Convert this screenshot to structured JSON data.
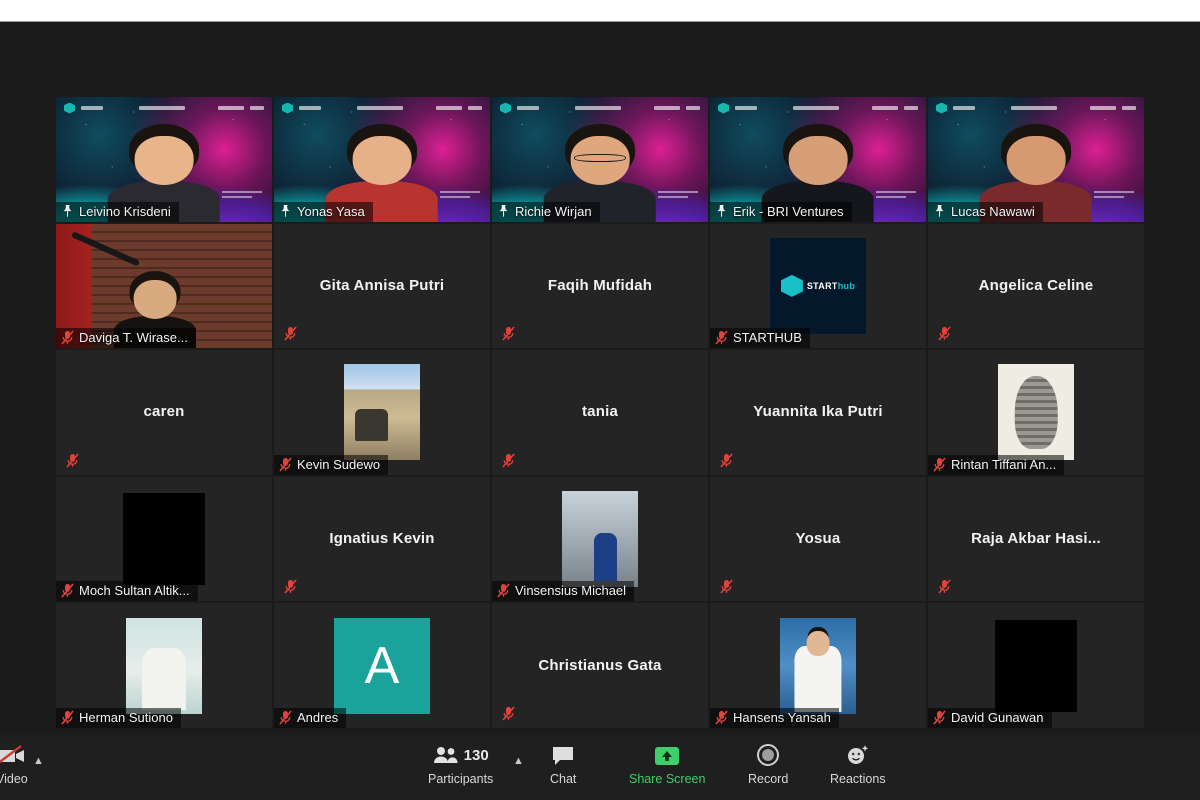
{
  "app": {
    "name": "Zoom Meeting",
    "layout": "gallery-view"
  },
  "gallery": {
    "columns": 5,
    "rows": 5,
    "active_speaker_border_color": "#c9e94a",
    "muted_icon_color": "#e0433c",
    "participants": [
      {
        "name": "Leivino Krisdeni",
        "display_name": "Leivino Krisdeni",
        "video": true,
        "muted": false,
        "pinned": true,
        "tile_type": "video-virtualbg",
        "skin": "#e8b48a",
        "shirt": "#2a2a30"
      },
      {
        "name": "Yonas Yasa",
        "display_name": "Yonas Yasa",
        "video": true,
        "muted": false,
        "pinned": true,
        "tile_type": "video-virtualbg",
        "skin": "#e6b089",
        "shirt": "#b8342f"
      },
      {
        "name": "Richie Wirjan",
        "display_name": "Richie Wirjan",
        "video": true,
        "muted": true,
        "pinned": true,
        "tile_type": "video-virtualbg",
        "skin": "#dfa77e",
        "shirt": "#20242a",
        "glasses": true
      },
      {
        "name": "Erik - BRI Ventures",
        "display_name": "Erik - BRI Ventures",
        "video": true,
        "muted": false,
        "pinned": true,
        "tile_type": "video-virtualbg",
        "skin": "#d79f78",
        "shirt": "#15171c"
      },
      {
        "name": "Lucas Nawawi",
        "display_name": "Lucas Nawawi",
        "video": true,
        "muted": false,
        "pinned": true,
        "tile_type": "video-virtualbg",
        "skin": "#d79a70",
        "shirt": "#7a2a2a",
        "active_speaker": true
      },
      {
        "name": "Daviga T. Wirase...",
        "display_name": "Daviga T. Wirase...",
        "video": true,
        "muted": true,
        "pinned": false,
        "tile_type": "video-brick"
      },
      {
        "name": "Gita Annisa Putri",
        "display_name": "Gita Annisa Putri",
        "video": false,
        "muted": true,
        "pinned": false,
        "tile_type": "name-only"
      },
      {
        "name": "Faqih Mufidah",
        "display_name": "Faqih Mufidah",
        "video": false,
        "muted": true,
        "pinned": false,
        "tile_type": "name-only"
      },
      {
        "name": "STARTHUB",
        "display_name": "STARTHUB",
        "video": false,
        "muted": true,
        "pinned": false,
        "tile_type": "avatar-starthub",
        "avatar_label": "STARThub"
      },
      {
        "name": "Angelica Celine",
        "display_name": "Angelica Celine",
        "video": false,
        "muted": true,
        "pinned": false,
        "tile_type": "name-only"
      },
      {
        "name": "caren",
        "display_name": "caren",
        "video": false,
        "muted": true,
        "pinned": false,
        "tile_type": "name-only"
      },
      {
        "name": "Kevin Sudewo",
        "display_name": "Kevin Sudewo",
        "video": false,
        "muted": true,
        "pinned": false,
        "tile_type": "avatar-photo",
        "avatar_style": "av-beach"
      },
      {
        "name": "tania",
        "display_name": "tania",
        "video": false,
        "muted": true,
        "pinned": false,
        "tile_type": "name-only"
      },
      {
        "name": "Yuannita Ika Putri",
        "display_name": "Yuannita Ika Putri",
        "video": false,
        "muted": true,
        "pinned": false,
        "tile_type": "name-only"
      },
      {
        "name": "Rintan Tiffani An...",
        "display_name": "Rintan Tiffani An...",
        "video": false,
        "muted": true,
        "pinned": false,
        "tile_type": "avatar-photo",
        "avatar_style": "av-pine"
      },
      {
        "name": "Moch Sultan Altik...",
        "display_name": "Moch Sultan Altik...",
        "video": false,
        "muted": true,
        "pinned": false,
        "tile_type": "avatar-photo",
        "avatar_style": "av-black"
      },
      {
        "name": "Ignatius Kevin",
        "display_name": "Ignatius Kevin",
        "video": false,
        "muted": true,
        "pinned": false,
        "tile_type": "name-only"
      },
      {
        "name": "Vinsensius Michael",
        "display_name": "Vinsensius Michael",
        "video": false,
        "muted": true,
        "pinned": false,
        "tile_type": "avatar-photo",
        "avatar_style": "av-street"
      },
      {
        "name": "Yosua",
        "display_name": "Yosua",
        "video": false,
        "muted": true,
        "pinned": false,
        "tile_type": "name-only"
      },
      {
        "name": "Raja Akbar Hasi...",
        "display_name": "Raja Akbar Hasi...",
        "video": false,
        "muted": true,
        "pinned": false,
        "tile_type": "name-only"
      },
      {
        "name": "Herman Sutiono",
        "display_name": "Herman Sutiono",
        "video": false,
        "muted": true,
        "pinned": false,
        "tile_type": "avatar-photo",
        "avatar_style": "av-herman"
      },
      {
        "name": "Andres",
        "display_name": "Andres",
        "video": false,
        "muted": true,
        "pinned": false,
        "tile_type": "avatar-initial",
        "initial": "A",
        "initial_bg": "#1aa39a"
      },
      {
        "name": "Christianus Gata",
        "display_name": "Christianus Gata",
        "video": false,
        "muted": true,
        "pinned": false,
        "tile_type": "name-only"
      },
      {
        "name": "Hansens Yansah",
        "display_name": "Hansens Yansah",
        "video": false,
        "muted": true,
        "pinned": false,
        "tile_type": "avatar-photo",
        "avatar_style": "av-hansens"
      },
      {
        "name": "David Gunawan",
        "display_name": "David Gunawan",
        "video": false,
        "muted": true,
        "pinned": false,
        "tile_type": "avatar-photo",
        "avatar_style": "av-black"
      }
    ]
  },
  "toolbar": {
    "video": {
      "label": "Video",
      "icon": "camera-off-icon",
      "state": "off",
      "has_caret": true
    },
    "participants": {
      "label": "Participants",
      "icon": "participants-icon",
      "count": "130",
      "has_caret": true
    },
    "chat": {
      "label": "Chat",
      "icon": "chat-icon"
    },
    "share_screen": {
      "label": "Share Screen",
      "icon": "share-screen-icon",
      "color": "#3fcf6a"
    },
    "record": {
      "label": "Record",
      "icon": "record-icon"
    },
    "reactions": {
      "label": "Reactions",
      "icon": "reactions-icon"
    }
  }
}
